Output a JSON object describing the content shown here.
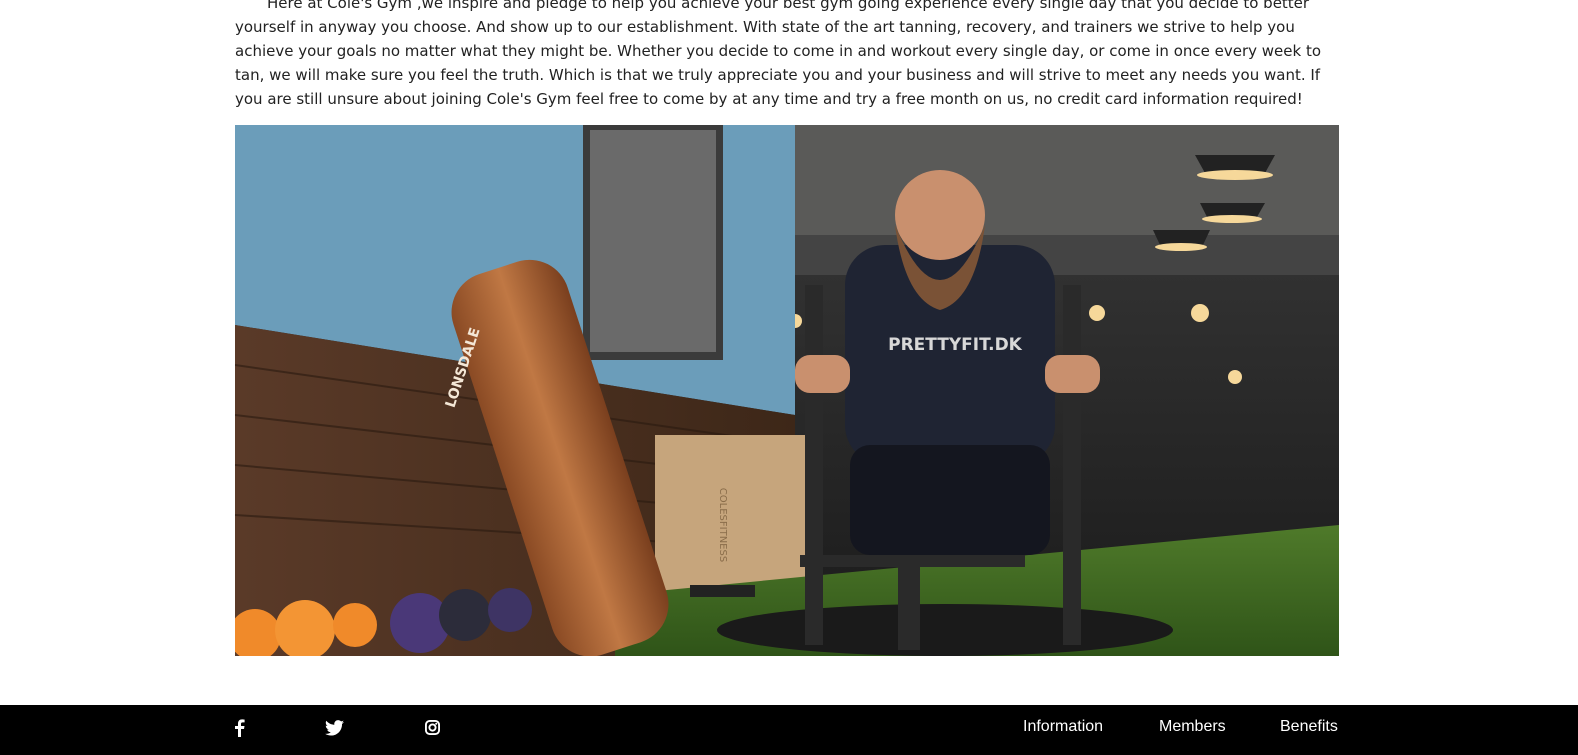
{
  "intro": {
    "text": "Here at Cole's Gym ,we inspire and pledge to help you achieve your best gym going experience every single day that you decide to better yourself in anyway you choose. And show up to our establishment. With state of the art tanning, recovery, and trainers we strive to help you achieve your goals no matter what they might be. Whether you decide to come in and workout every single day, or come in once every week to tan, we will make sure you feel the truth. Which is that we truly appreciate you and your business and will strive to meet any needs you want. If you are still unsure about joining Cole's Gym feel free to come by at any time and try a free month on us, no credit card information required!"
  },
  "hero": {
    "shirt_text": "PRETTYFIT.DK",
    "bag_brand": "LONSDALE",
    "box_text": "COLESFITNESS"
  },
  "footer": {
    "social_icons": [
      "facebook-icon",
      "twitter-icon",
      "instagram-icon"
    ],
    "nav": [
      "Information",
      "Members",
      "Benefits"
    ]
  },
  "colors": {
    "footer_bg": "#000000",
    "footer_text": "#ffffff",
    "body_text": "#222222"
  }
}
